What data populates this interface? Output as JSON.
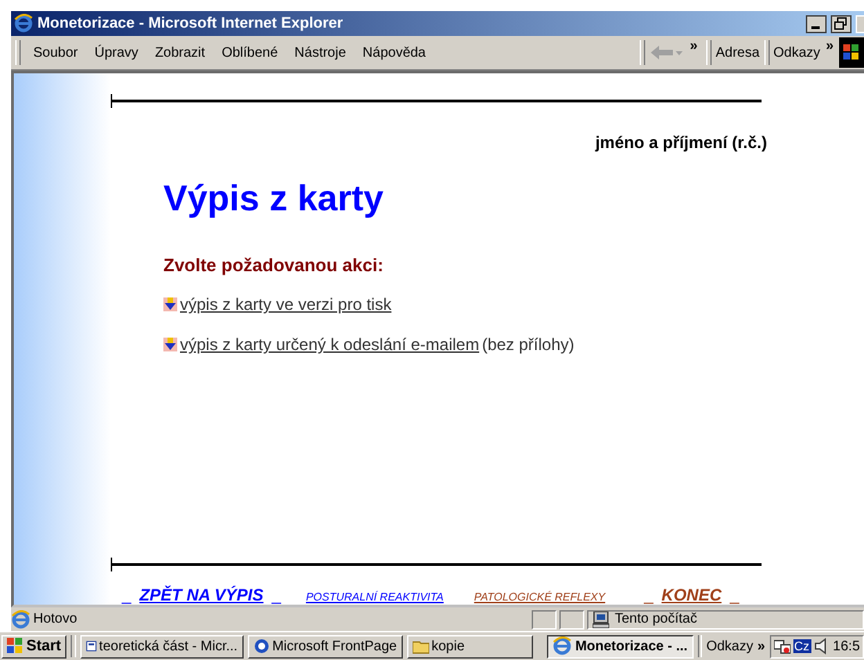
{
  "window": {
    "title": "Monetorizace - Microsoft Internet Explorer"
  },
  "menu": [
    "Soubor",
    "Úpravy",
    "Zobrazit",
    "Oblíbené",
    "Nástroje",
    "Nápověda"
  ],
  "toolbar": {
    "chevron": "»",
    "address_label": "Adresa",
    "links_label": "Odkazy",
    "links_chevron": "»"
  },
  "page": {
    "user": "jméno a příjmení (r.č.)",
    "heading": "Výpis z karty",
    "prompt": "Zvolte požadovanou akci:",
    "actions": [
      {
        "link": "výpis z karty ve verzi pro tisk"
      },
      {
        "link": "výpis z karty určený k odeslání e-mailem",
        "note": "(bez přílohy)"
      }
    ],
    "footer": [
      {
        "kind": "big",
        "text": "ZPĚT NA VÝPIS",
        "color": "#0000ff",
        "mark": "_"
      },
      {
        "kind": "small",
        "text": "POSTURALNÍ REAKTIVITA",
        "color": "#0000ff"
      },
      {
        "kind": "small",
        "text": "PATOLOGICKÉ REFLEXY",
        "color": "#a0401a"
      },
      {
        "kind": "big",
        "text": "KONEC",
        "color": "#a0401a",
        "mark": "_"
      }
    ]
  },
  "status_bar": {
    "text": "Hotovo",
    "zone": "Tento počítač"
  },
  "taskbar": {
    "start": "Start",
    "tasks": [
      {
        "label": "teoretická část - Micr...",
        "selected": false
      },
      {
        "label": "Microsoft FrontPage",
        "selected": false
      },
      {
        "label": "kopie",
        "selected": false
      },
      {
        "label": "Monetorizace - ...",
        "selected": true
      }
    ],
    "links_label": "Odkazy",
    "links_chevron": "»",
    "tray_lang": "Cz",
    "clock": "16:5"
  }
}
